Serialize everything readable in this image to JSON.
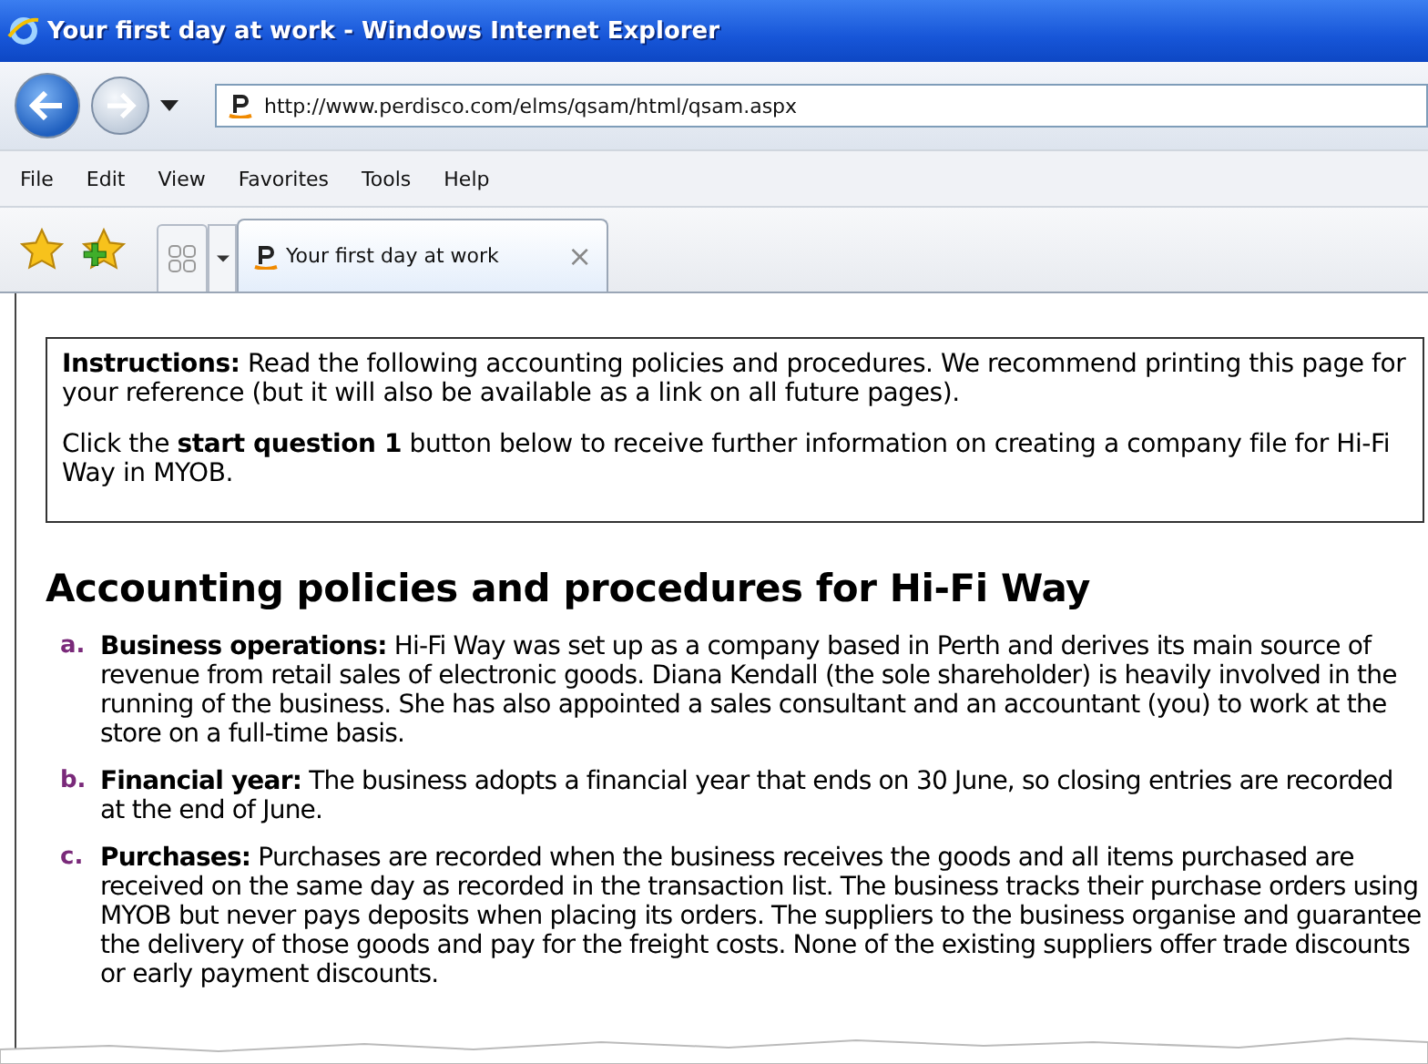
{
  "window": {
    "title": "Your first day at work - Windows Internet Explorer"
  },
  "address": {
    "url": "http://www.perdisco.com/elms/qsam/html/qsam.aspx"
  },
  "menu": [
    "File",
    "Edit",
    "View",
    "Favorites",
    "Tools",
    "Help"
  ],
  "tab": {
    "title": "Your first day at work",
    "close": "×"
  },
  "instructions": [
    "**Instructions:** Read the following accounting policies and procedures. We recommend printing this page for your reference (but it will also be available as a link on all future pages).",
    "Click the **start question 1** button below to receive further information on creating a company file for Hi-Fi Way in MYOB."
  ],
  "heading": "Accounting policies and procedures for Hi-Fi Way",
  "items": [
    {
      "letter": "a.",
      "text": "**Business operations:** Hi-Fi Way was set up as a company based in Perth and derives its main source of revenue from retail sales of electronic goods. Diana Kendall (the sole shareholder) is heavily involved in the running of the business. She has also appointed a sales consultant and an accountant (you) to work at the store on a full-time basis."
    },
    {
      "letter": "b.",
      "text": "**Financial year:** The business adopts a financial year that ends on 30 June, so closing entries are recorded at the end of June."
    },
    {
      "letter": "c.",
      "text": "**Purchases:** Purchases are recorded when the business receives the goods and all items purchased are received on the same day as recorded in the transaction list. The business tracks their purchase orders using MYOB but never pays deposits when placing its orders. The suppliers to the business organise and guarantee the delivery of those goods and pay for the freight costs. None of the existing suppliers offer trade discounts or early payment discounts."
    }
  ]
}
